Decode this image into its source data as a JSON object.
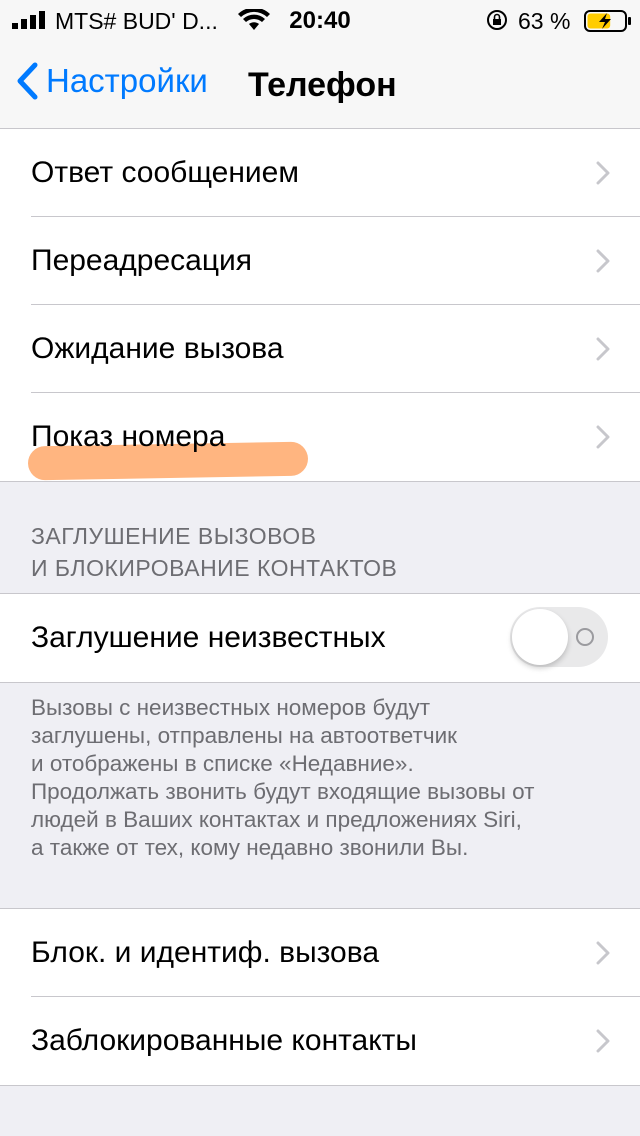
{
  "status_bar": {
    "carrier": "MTS# BUD' D...",
    "time": "20:40",
    "battery_percent": "63 %",
    "battery_level": 0.63,
    "icons": [
      "signal-icon",
      "wifi-icon",
      "orientation-lock-icon",
      "battery-charging-icon"
    ]
  },
  "nav": {
    "back_label": "Настройки",
    "title": "Телефон"
  },
  "group1": {
    "items": [
      {
        "label": "Ответ сообщением"
      },
      {
        "label": "Переадресация"
      },
      {
        "label": "Ожидание вызова"
      },
      {
        "label": "Показ номера"
      }
    ]
  },
  "section": {
    "header": "ЗАГЛУШЕНИЕ ВЫЗОВОВ\nИ БЛОКИРОВАНИЕ КОНТАКТОВ",
    "toggle_label": "Заглушение неизвестных",
    "toggle_on": false,
    "footer": "Вызовы с неизвестных номеров будут\nзаглушены, отправлены на автоответчик\nи отображены в списке «Недавние».\nПродолжать звонить будут входящие вызовы от\nлюдей в Ваших контактах и предложениях Siri,\nа также от тех, кому недавно звонили Вы."
  },
  "group3": {
    "items": [
      {
        "label": "Блок. и идентиф. вызова"
      },
      {
        "label": "Заблокированные контакты"
      }
    ]
  },
  "colors": {
    "accent": "#007aff",
    "highlight": "#ffa86a",
    "background": "#efeff4"
  }
}
